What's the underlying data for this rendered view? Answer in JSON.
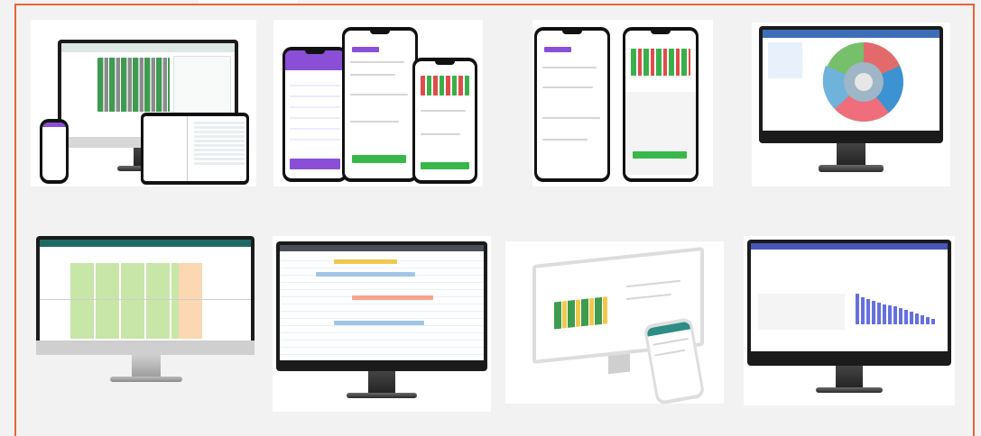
{
  "page": {
    "frame_color": "#e8643a",
    "background": "#f2f2f2"
  },
  "gallery": {
    "tiles": [
      {
        "id": "multi-device-roster",
        "devices": [
          "desktop-monitor",
          "tablet",
          "phone"
        ]
      },
      {
        "id": "mobile-unfilled-shifts-app",
        "devices": [
          "phone",
          "phone",
          "phone"
        ]
      },
      {
        "id": "mobile-study-hours-app",
        "devices": [
          "phone",
          "phone"
        ]
      },
      {
        "id": "sunburst-chart-dashboard",
        "devices": [
          "desktop-monitor"
        ]
      },
      {
        "id": "weekly-shift-calendar",
        "devices": [
          "desktop-monitor"
        ]
      },
      {
        "id": "gantt-roster-view",
        "devices": [
          "desktop-monitor"
        ]
      },
      {
        "id": "desktop-and-phone-roster",
        "devices": [
          "desktop-monitor",
          "phone"
        ]
      },
      {
        "id": "bar-chart-report",
        "devices": [
          "desktop-monitor"
        ]
      }
    ]
  }
}
